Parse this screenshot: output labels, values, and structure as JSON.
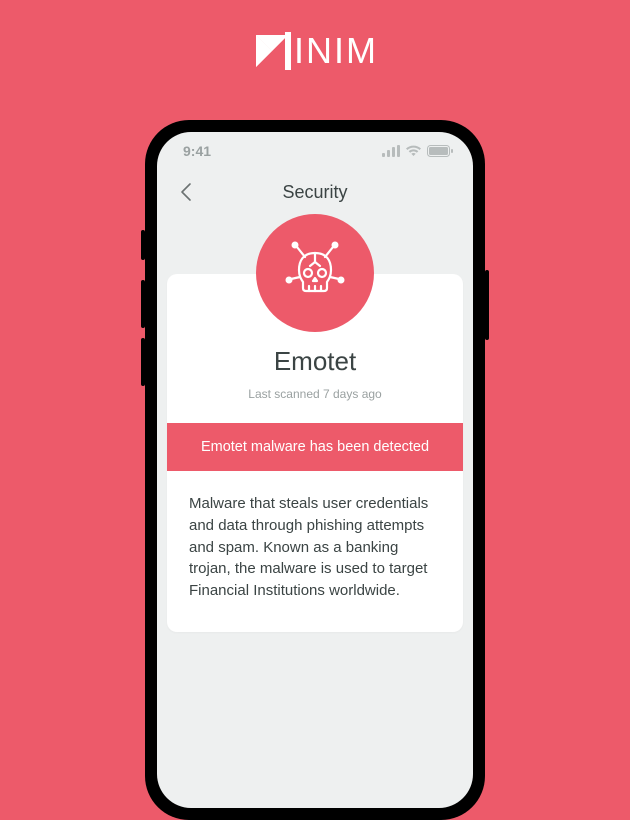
{
  "brand": {
    "name": "INIM"
  },
  "status_bar": {
    "time": "9:41"
  },
  "header": {
    "title": "Security"
  },
  "threat": {
    "name": "Emotet",
    "last_scanned": "Last scanned 7 days ago",
    "alert": "Emotet malware has been detected",
    "description": "Malware that steals user credentials and data through phishing attempts and spam. Known as a banking trojan, the malware is used to target Financial Institutions worldwide."
  },
  "colors": {
    "accent": "#ed5a6a"
  }
}
